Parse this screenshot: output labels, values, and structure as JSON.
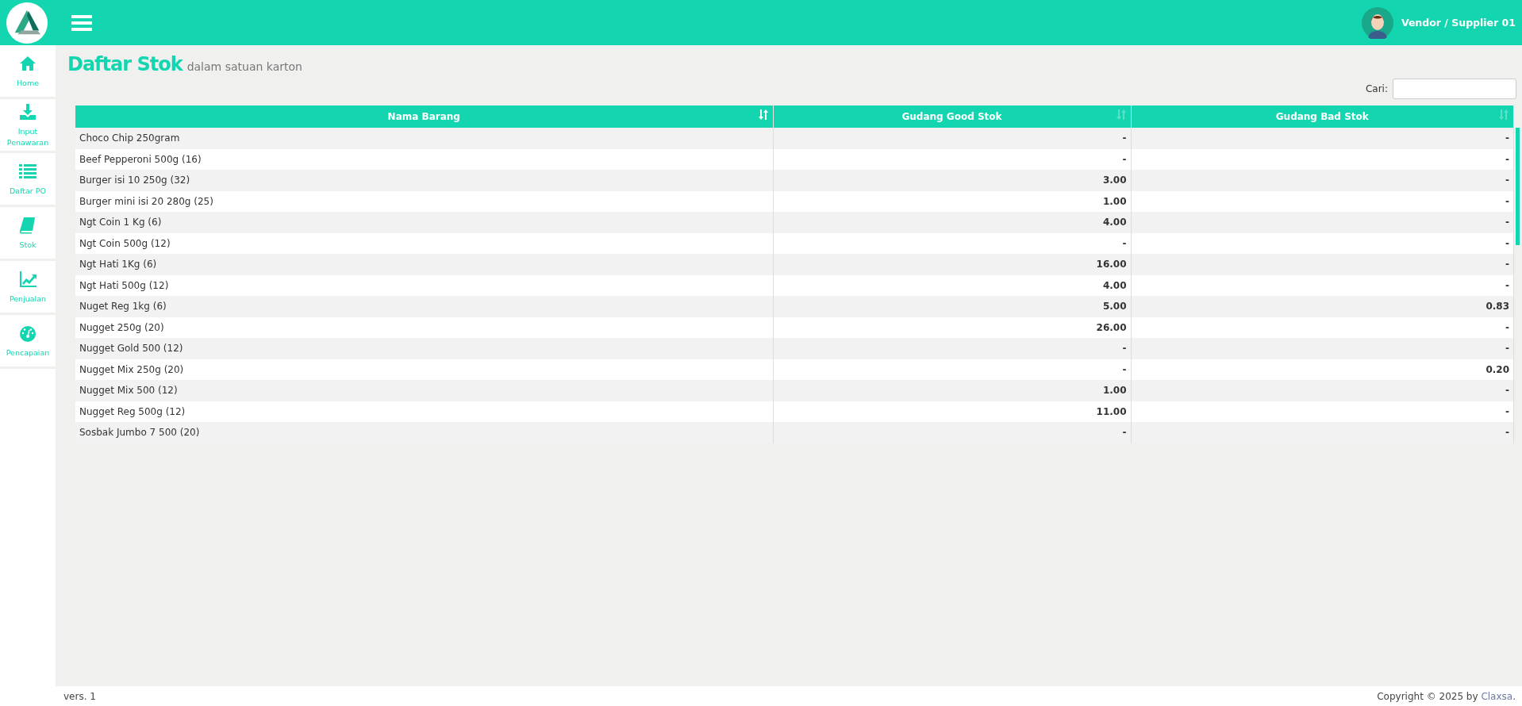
{
  "header": {
    "user_name": "Vendor / Supplier 01"
  },
  "sidebar": {
    "items": [
      {
        "label": "Home"
      },
      {
        "label": "Input Penawaran"
      },
      {
        "label": "Daftar PO"
      },
      {
        "label": "Stok"
      },
      {
        "label": "Penjualan"
      },
      {
        "label": "Pencapaian"
      }
    ]
  },
  "page": {
    "title": "Daftar Stok",
    "subtitle": "dalam satuan karton"
  },
  "search": {
    "label": "Cari:"
  },
  "table": {
    "columns": [
      {
        "label": "Nama Barang",
        "sorted": true
      },
      {
        "label": "Gudang Good Stok",
        "sorted": false
      },
      {
        "label": "Gudang Bad Stok",
        "sorted": false
      }
    ],
    "rows": [
      [
        "Choco Chip 250gram",
        "-",
        "-"
      ],
      [
        "Beef Pepperoni 500g (16)",
        "-",
        "-"
      ],
      [
        "Burger isi 10 250g (32)",
        "3.00",
        "-"
      ],
      [
        "Burger mini isi 20 280g (25)",
        "1.00",
        "-"
      ],
      [
        "Ngt Coin 1 Kg (6)",
        "4.00",
        "-"
      ],
      [
        "Ngt Coin 500g (12)",
        "-",
        "-"
      ],
      [
        "Ngt Hati 1Kg (6)",
        "16.00",
        "-"
      ],
      [
        "Ngt Hati 500g (12)",
        "4.00",
        "-"
      ],
      [
        "Nuget Reg 1kg (6)",
        "5.00",
        "0.83"
      ],
      [
        "Nugget 250g (20)",
        "26.00",
        "-"
      ],
      [
        "Nugget Gold 500 (12)",
        "-",
        "-"
      ],
      [
        "Nugget Mix 250g (20)",
        "-",
        "0.20"
      ],
      [
        "Nugget Mix 500 (12)",
        "1.00",
        "-"
      ],
      [
        "Nugget Reg 500g (12)",
        "11.00",
        "-"
      ],
      [
        "Sosbak Jumbo 7 500 (20)",
        "-",
        "-"
      ]
    ]
  },
  "footer": {
    "version": "vers. 1",
    "copyright": "Copyright © 2025 by ",
    "company_link": "Claxsa",
    "end": "."
  }
}
